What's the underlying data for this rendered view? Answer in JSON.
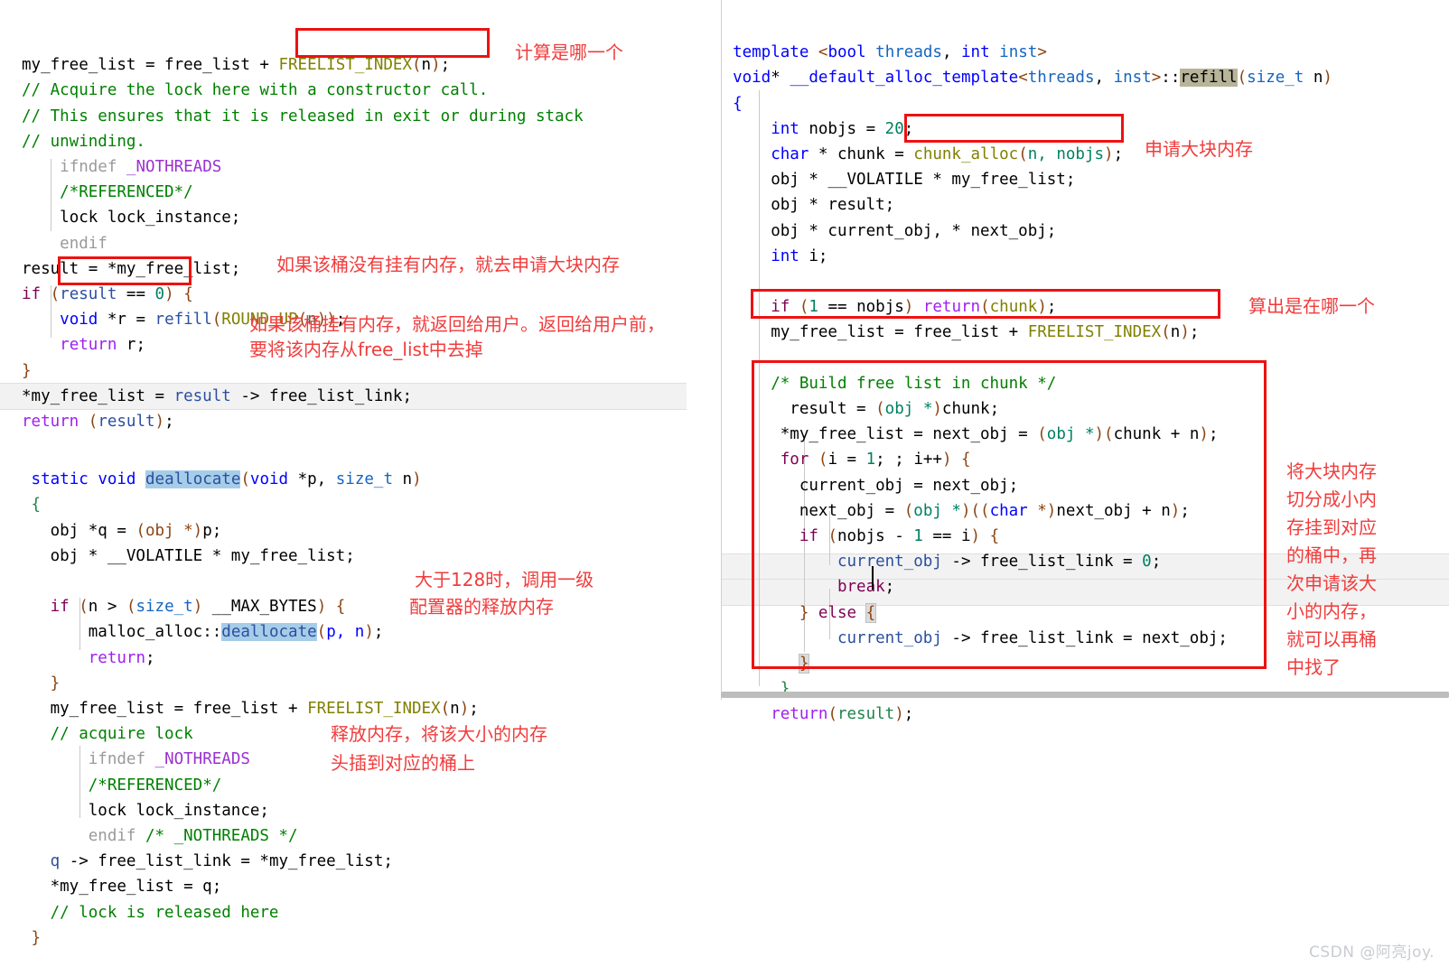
{
  "left_panel": {
    "name": "allocate-code-block",
    "lines": [
      "my_free_list = free_list + FREELIST_INDEX(n);",
      "// Acquire the lock here with a constructor call.",
      "// This ensures that it is released in exit or during stack",
      "// unwinding.",
      "    ifndef _NOTHREADS",
      "    /*REFERENCED*/",
      "    lock lock_instance;",
      "    endif",
      "result = *my_free_list;",
      "if (result == 0) {",
      "    void *r = refill(ROUND_UP(n));",
      "    return r;",
      "}",
      "*my_free_list = result -> free_list_link;",
      "return (result);"
    ],
    "deallocate_lines": [
      " static void deallocate(void *p, size_t n)",
      " {",
      "   obj *q = (obj *)p;",
      "   obj * __VOLATILE * my_free_list;",
      "",
      "   if (n > (size_t) __MAX_BYTES) {",
      "       malloc_alloc::deallocate(p, n);",
      "       return;",
      "   }",
      "   my_free_list = free_list + FREELIST_INDEX(n);",
      "   // acquire lock",
      "       ifndef _NOTHREADS",
      "       /*REFERENCED*/",
      "       lock lock_instance;",
      "       endif /* _NOTHREADS */",
      "   q -> free_list_link = *my_free_list;",
      "   *my_free_list = q;",
      "   // lock is released here",
      " }"
    ]
  },
  "right_panel": {
    "name": "refill-code-block",
    "lines": [
      "template <bool threads, int inst>",
      "void* __default_alloc_template<threads, inst>::refill(size_t n)",
      "{",
      "    int nobjs = 20;",
      "    char * chunk = chunk_alloc(n, nobjs);",
      "    obj * __VOLATILE * my_free_list;",
      "    obj * result;",
      "    obj * current_obj, * next_obj;",
      "    int i;",
      "",
      "    if (1 == nobjs) return(chunk);",
      "    my_free_list = free_list + FREELIST_INDEX(n);",
      "",
      "    /* Build free list in chunk */",
      "      result = (obj *)chunk;",
      "     *my_free_list = next_obj = (obj *)(chunk + n);",
      "     for (i = 1; ; i++) {",
      "       current_obj = next_obj;",
      "       next_obj = (obj *)((char *)next_obj + n);",
      "       if (nobjs - 1 == i) {",
      "           current_obj -> free_list_link = 0;",
      "           break;",
      "       } else {",
      "           current_obj -> free_list_link = next_obj;",
      "       }",
      "     }",
      "    return(result);"
    ]
  },
  "annotations": {
    "a1": "计算是哪一个",
    "a2": "如果该桶没有挂有内存，就去申请大块内存",
    "a3_l1": "如果该桶挂有内存，就返回给用户。返回给用户前，",
    "a3_l2": "要将该内存从free_list中去掉",
    "a4_l1": "大于128时，调用一级",
    "a4_l2": "配置器的释放内存",
    "a5_l1": "释放内存，将该大小的内存",
    "a5_l2": "头插到对应的桶上",
    "a6": "申请大块内存",
    "a7": "算出是在哪一个",
    "a8": "将大块内存\n切分成小内\n存挂到对应\n的桶中，再\n次申请该大\n小的内存，\n就可以再桶\n中找了"
  },
  "watermark": "CSDN @阿亮joy.",
  "colors": {
    "annotation_red": "#f03c3c",
    "box_red": "#ee1111",
    "comment_green": "#008000",
    "keyword_blue": "#0000ff",
    "control_purple": "#7f0055",
    "macro_olive": "#808000",
    "selection_blue": "#a6cde8",
    "occurrence_olive": "#b8b49a"
  }
}
